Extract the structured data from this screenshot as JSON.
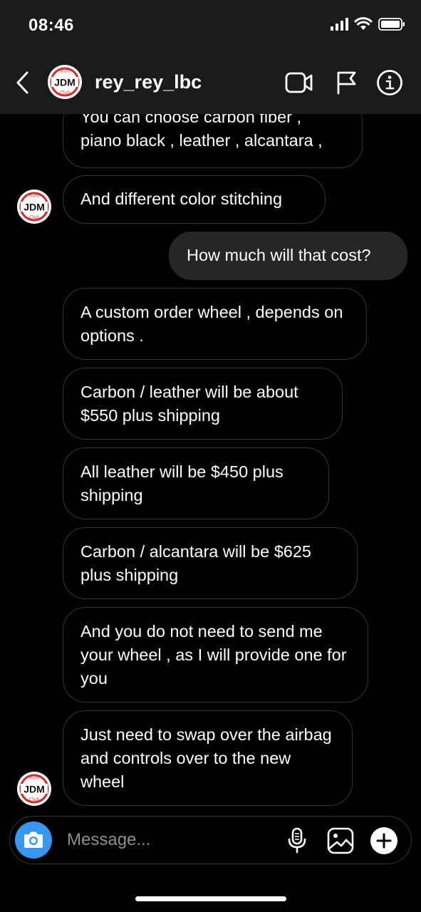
{
  "status_bar": {
    "time": "08:46"
  },
  "header": {
    "username": "rey_rey_lbc",
    "avatar_icon": "jdm-auto-club-logo"
  },
  "avatar_logo": {
    "line1": "Auto",
    "main": "JDM",
    "line2": "Club"
  },
  "messages": [
    {
      "direction": "incoming",
      "text": "You can choose carbon fiber , piano black , leather , alcantara ,"
    },
    {
      "direction": "incoming",
      "text": "And different color stitching"
    },
    {
      "direction": "outgoing",
      "text": "How much will that cost?"
    },
    {
      "direction": "incoming",
      "text": "A custom order wheel , depends on options ."
    },
    {
      "direction": "incoming",
      "text": "Carbon / leather will be about $550 plus shipping"
    },
    {
      "direction": "incoming",
      "text": "All leather will be $450 plus shipping"
    },
    {
      "direction": "incoming",
      "text": "Carbon / alcantara will be $625 plus shipping"
    },
    {
      "direction": "incoming",
      "text": "And you do not need to send me your wheel , as I will provide one for you"
    },
    {
      "direction": "incoming",
      "text": "Just need to swap over the airbag and controls over to the new wheel"
    }
  ],
  "composer": {
    "placeholder": "Message..."
  },
  "colors": {
    "background": "#000000",
    "bar": "#1a1a1a",
    "incoming_border": "#363636",
    "outgoing_fill": "#262626",
    "camera_button": "#3897f0",
    "placeholder": "#8e8e8e",
    "logo_red": "#d12a2a"
  }
}
